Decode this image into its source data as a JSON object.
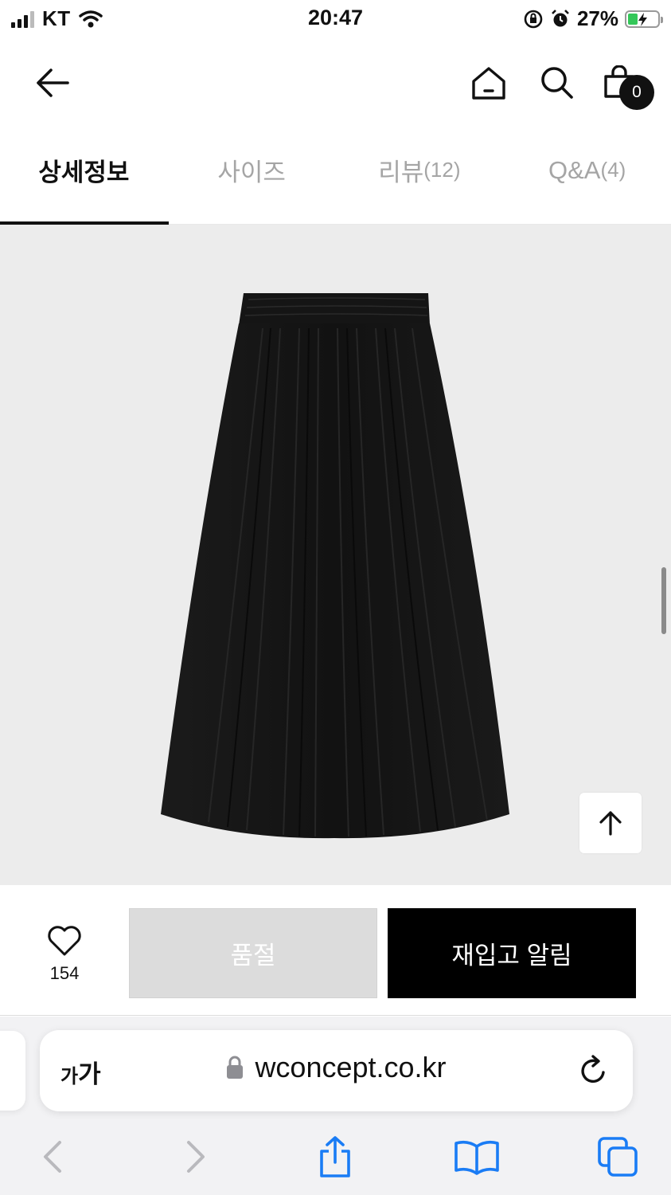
{
  "status_bar": {
    "carrier": "KT",
    "time": "20:47",
    "battery_percent": "27%",
    "battery_level": 0.27,
    "icons": [
      "signal-icon",
      "wifi-icon",
      "orientation-lock-icon",
      "alarm-icon",
      "battery-charging-icon"
    ]
  },
  "header": {
    "icons": [
      "back-arrow-icon",
      "home-icon",
      "search-icon",
      "shopping-bag-icon"
    ],
    "cart_count": "0"
  },
  "tabs": [
    {
      "label": "상세정보",
      "count": "",
      "active": true
    },
    {
      "label": "사이즈",
      "count": "",
      "active": false
    },
    {
      "label": "리뷰",
      "count": "(12)",
      "active": false
    },
    {
      "label": "Q&A",
      "count": "(4)",
      "active": false
    }
  ],
  "product": {
    "image": "black-pleated-midi-skirt",
    "scroll_top_icon": "arrow-up-icon"
  },
  "purchase": {
    "like_count": "154",
    "like_icon": "heart-icon",
    "soldout_label": "품절",
    "restock_label": "재입고 알림"
  },
  "browser": {
    "aa_small": "가",
    "aa_large": "가",
    "url": "wconcept.co.kr",
    "icons": [
      "lock-icon",
      "reload-icon",
      "back-chevron-icon",
      "forward-chevron-icon",
      "share-icon",
      "bookmarks-icon",
      "tabs-icon"
    ]
  },
  "colors": {
    "accent": "#000000",
    "product_bg": "#ececec",
    "soldout_bg": "#dcdcdc",
    "safari_blue": "#1a7cf5",
    "battery_green": "#34c759"
  }
}
